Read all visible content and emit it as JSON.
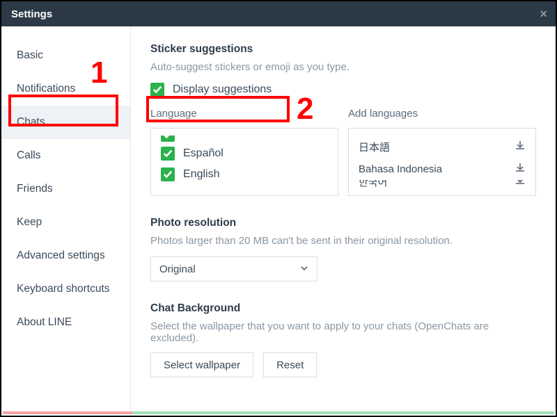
{
  "title": "Settings",
  "sidebar": {
    "items": [
      {
        "label": "Basic"
      },
      {
        "label": "Notifications"
      },
      {
        "label": "Chats"
      },
      {
        "label": "Calls"
      },
      {
        "label": "Friends"
      },
      {
        "label": "Keep"
      },
      {
        "label": "Advanced settings"
      },
      {
        "label": "Keyboard shortcuts"
      },
      {
        "label": "About LINE"
      }
    ],
    "selected_index": 2
  },
  "sticker": {
    "heading": "Sticker suggestions",
    "desc": "Auto-suggest stickers or emoji as you type.",
    "checkbox_label": "Display suggestions",
    "language_label": "Language",
    "add_languages_label": "Add languages",
    "languages": [
      {
        "label": "Español"
      },
      {
        "label": "English"
      }
    ],
    "add_languages": [
      {
        "label": "日本語"
      },
      {
        "label": "Bahasa Indonesia"
      },
      {
        "label": "한국어"
      }
    ]
  },
  "photo": {
    "heading": "Photo resolution",
    "desc": "Photos larger than 20 MB can't be sent in their original resolution.",
    "select_value": "Original"
  },
  "background": {
    "heading": "Chat Background",
    "desc": "Select the wallpaper that you want to apply to your chats (OpenChats are excluded).",
    "select_btn": "Select wallpaper",
    "reset_btn": "Reset"
  },
  "annotations": {
    "one": "1",
    "two": "2"
  }
}
